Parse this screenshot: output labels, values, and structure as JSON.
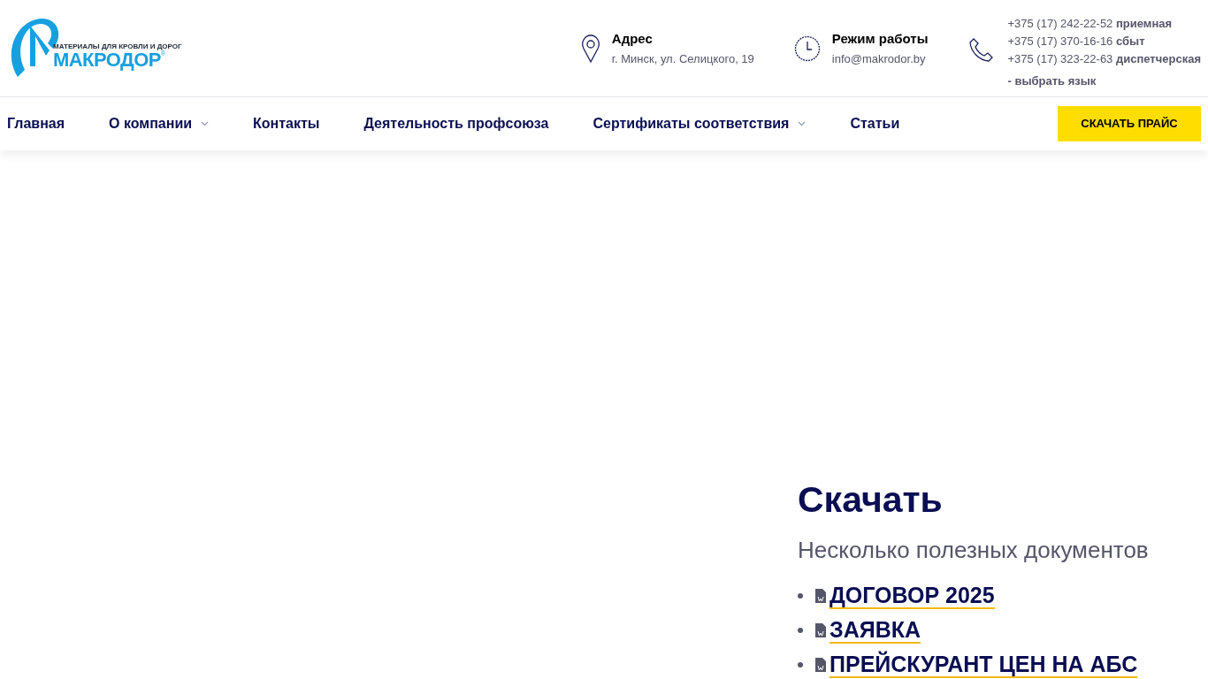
{
  "logo": {
    "tagline": "МАТЕРИАЛЫ ДЛЯ КРОВЛИ И ДОРОГ",
    "name": "МАКРОДОР",
    "mark": "®"
  },
  "contacts": [
    {
      "kind": "address",
      "title": "Адрес",
      "text": "г. Минск, ул. Селицкого, 19"
    },
    {
      "kind": "hours",
      "title": "Режим работы",
      "text": "info@makrodor.by"
    }
  ],
  "phones": [
    {
      "number": "+375 (17) 242-22-52",
      "label": "приемная"
    },
    {
      "number": "+375 (17) 370-16-16",
      "label": "сбыт"
    },
    {
      "number": "+375 (17) 323-22-63",
      "label": "диспетчерская"
    }
  ],
  "language_link": "- выбрать язык",
  "nav": [
    {
      "label": "Главная",
      "dropdown": false
    },
    {
      "label": "О компании",
      "dropdown": true
    },
    {
      "label": "Контакты",
      "dropdown": false
    },
    {
      "label": "Деятельность профсоюза",
      "dropdown": false
    },
    {
      "label": "Сертификаты соответствия",
      "dropdown": true
    },
    {
      "label": "Статьи",
      "dropdown": false
    }
  ],
  "price_button": "СКАЧАТЬ ПРАЙС",
  "downloads": {
    "title": "Скачать",
    "subtitle": "Несколько полезных документов",
    "items": [
      "ДОГОВОР 2025",
      "ЗАЯВКА",
      "ПРЕЙСКУРАНТ ЦЕН НА АБС"
    ]
  }
}
